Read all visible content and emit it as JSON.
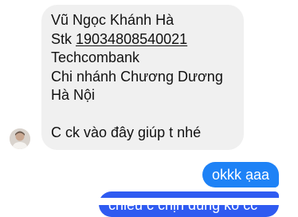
{
  "thread": {
    "incoming": {
      "lines": {
        "name": "Vũ Ngọc Khánh Hà",
        "stk_prefix": "Stk ",
        "stk_number": "19034808540021",
        "bank": "Techcombank",
        "branch": "Chi nhánh Chương Dương",
        "city": "Hà Nội",
        "request": "C ck vào đây giúp t nhé"
      }
    },
    "outgoing": [
      {
        "text": "okkk ạaa"
      },
      {
        "text": "chiều c chịn đúng ko cc"
      }
    ]
  },
  "colors": {
    "incoming_bubble": "#f0f0f0",
    "outgoing_bubble": "#1e82f6",
    "outgoing_bubble_2": "#2f5bf1"
  }
}
